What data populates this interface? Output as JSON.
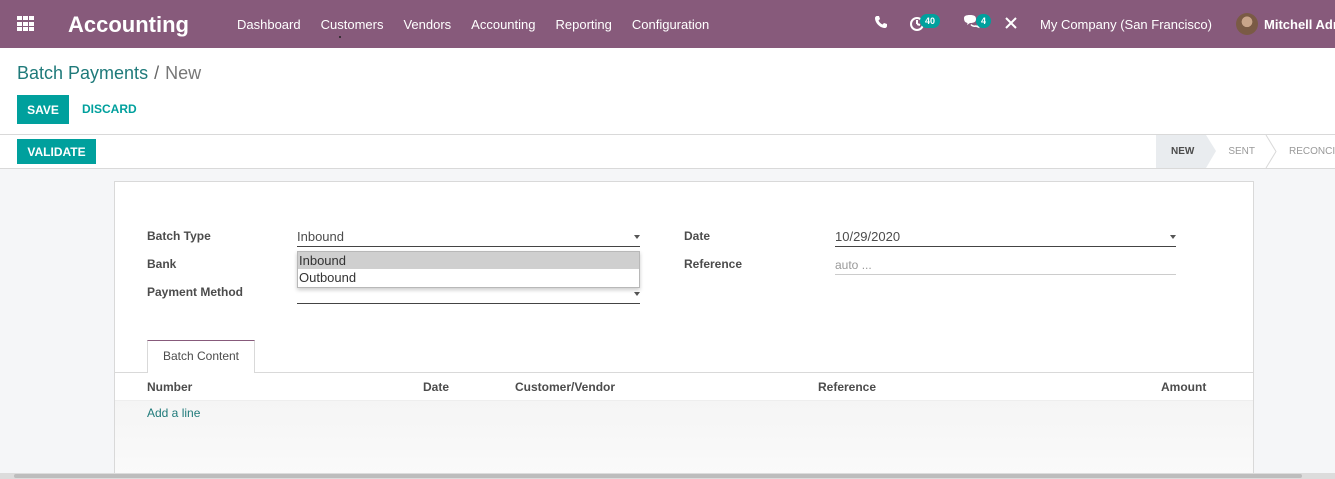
{
  "navbar": {
    "app_title": "Accounting",
    "menu": [
      "Dashboard",
      "Customers",
      "Vendors",
      "Accounting",
      "Reporting",
      "Configuration"
    ],
    "activity_count": "40",
    "message_count": "4",
    "company": "My Company (San Francisco)",
    "user": "Mitchell Adm",
    "icons": [
      "apps-icon",
      "phone-icon",
      "activity-icon",
      "chat-icon",
      "close-icon"
    ]
  },
  "breadcrumb": {
    "parent": "Batch Payments",
    "separator": "/",
    "current": "New"
  },
  "actions": {
    "save": "SAVE",
    "discard": "DISCARD",
    "validate": "VALIDATE"
  },
  "stages": [
    "NEW",
    "SENT",
    "RECONCIL"
  ],
  "active_stage": "NEW",
  "form": {
    "batch_type_label": "Batch Type",
    "batch_type_value": "Inbound",
    "batch_type_options": [
      "Inbound",
      "Outbound"
    ],
    "bank_label": "Bank",
    "payment_method_label": "Payment Method",
    "date_label": "Date",
    "date_value": "10/29/2020",
    "reference_label": "Reference",
    "reference_placeholder": "auto ..."
  },
  "tabs": [
    "Batch Content"
  ],
  "table": {
    "columns": [
      "Number",
      "Date",
      "Customer/Vendor",
      "Reference",
      "Amount"
    ],
    "add_line": "Add a line"
  },
  "colors": {
    "navbar": "#875a7b",
    "primary": "#00a09d",
    "link": "#1f7a7a"
  }
}
